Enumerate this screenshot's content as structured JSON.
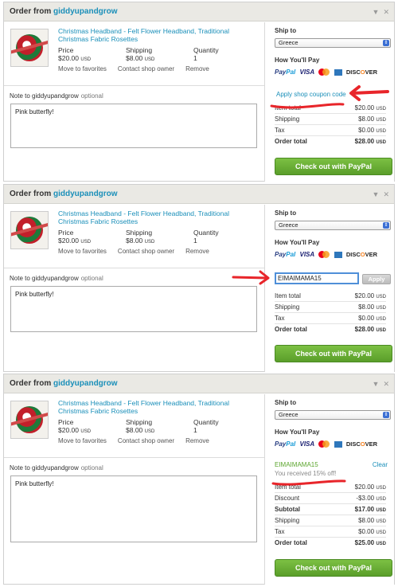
{
  "order": {
    "title_prefix": "Order from",
    "shop_name": "giddyupandgrow",
    "icons": [
      "chevron-down-icon",
      "close-icon"
    ]
  },
  "item": {
    "title": "Christmas Headband - Felt Flower Headband, Traditional Christmas Fabric Rosettes",
    "price_label": "Price",
    "price_value": "$20.00",
    "currency": "USD",
    "shipping_label": "Shipping",
    "shipping_value": "$8.00",
    "quantity_label": "Quantity",
    "quantity_value": "1",
    "link_favorites": "Move to favorites",
    "link_contact": "Contact shop owner",
    "link_remove": "Remove"
  },
  "note": {
    "label": "Note to giddyupandgrow",
    "optional": "optional",
    "value": "Pink butterfly!"
  },
  "payment": {
    "ship_to_label": "Ship to",
    "ship_to_value": "Greece",
    "how_pay_label": "How You'll Pay",
    "methods": [
      "PayPal",
      "VISA",
      "MasterCard",
      "Amex",
      "DISCOVER"
    ],
    "paypal_a": "Pay",
    "paypal_b": "Pal",
    "visa": "VISA",
    "discover_a": "DISC",
    "discover_o": "O",
    "discover_b": "VER"
  },
  "coupon": {
    "link": "Apply shop coupon code",
    "code": "EIMAIMAMA15",
    "apply_label": "Apply",
    "applied_code": "EIMAIMAMA15",
    "clear_label": "Clear",
    "received": "You received 15% off!"
  },
  "totals": {
    "item_total_label": "Item total",
    "item_total": "$20.00",
    "discount_label": "Discount",
    "discount": "-$3.00",
    "subtotal_label": "Subtotal",
    "subtotal": "$17.00",
    "shipping_label": "Shipping",
    "shipping": "$8.00",
    "tax_label": "Tax",
    "tax": "$0.00",
    "order_total_label": "Order total",
    "order_total_1": "$28.00",
    "order_total_2": "$28.00",
    "order_total_3": "$25.00",
    "currency": "USD"
  },
  "checkout_label": "Check out with PayPal",
  "colors": {
    "link": "#1a8fb9",
    "checkout_green": "#6bb23a",
    "annotation_red": "#e8252a",
    "header_bg": "#eae9e4",
    "applied_green": "#5ba52d"
  }
}
